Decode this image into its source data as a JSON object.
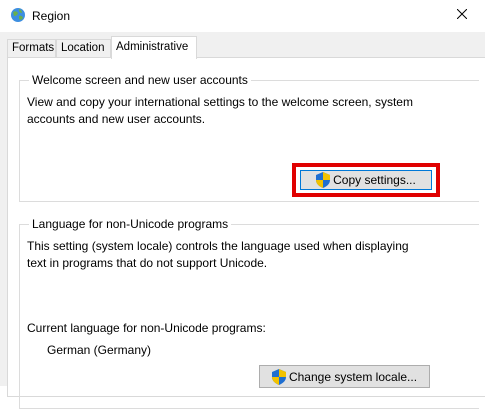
{
  "window": {
    "title": "Region"
  },
  "tabs": [
    {
      "label": "Formats",
      "active": false
    },
    {
      "label": "Location",
      "active": false
    },
    {
      "label": "Administrative",
      "active": true
    }
  ],
  "welcome_group": {
    "legend": "Welcome screen and new user accounts",
    "description": "View and copy your international settings to the welcome screen, system accounts and new user accounts.",
    "copy_button_label": "Copy settings...",
    "highlight_color": "#e00000"
  },
  "language_group": {
    "legend": "Language for non-Unicode programs",
    "description": "This setting (system locale) controls the language used when displaying text in programs that do not support Unicode.",
    "current_label": "Current language for non-Unicode programs:",
    "current_value": "German (Germany)",
    "change_button_label": "Change system locale..."
  },
  "icons": {
    "app": "globe-icon",
    "close": "close-icon",
    "uac": "uac-shield-icon"
  }
}
